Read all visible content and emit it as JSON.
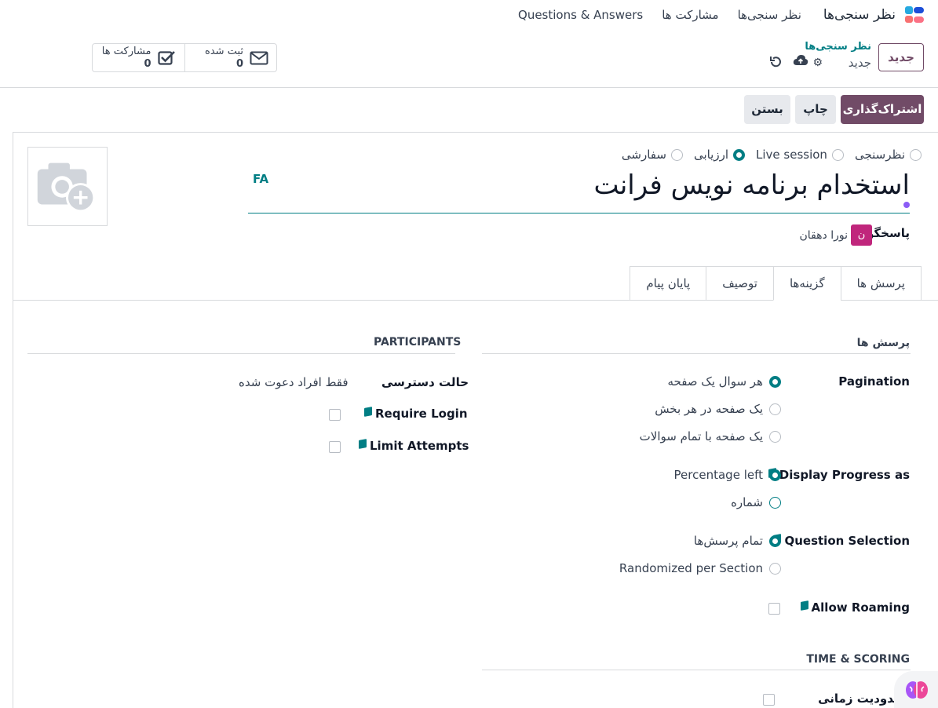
{
  "navbar": {
    "app_title": "نظر سنجی‌ها",
    "menu": [
      "نظر سنجی‌ها",
      "مشارکت ها",
      "Questions & Answers"
    ]
  },
  "header": {
    "new_button": "جدید",
    "breadcrumb_parent": "نظر سنجی‌ها",
    "breadcrumb_current": "جدید",
    "stats": [
      {
        "label": "ثبت شده",
        "value": "0",
        "icon": "envelope-icon"
      },
      {
        "label": "مشارکت ها",
        "value": "0",
        "icon": "checkbox-icon"
      }
    ]
  },
  "actions": {
    "share": "اشتراک‌گذاری",
    "print": "چاپ",
    "close": "بستن"
  },
  "form": {
    "survey_types": [
      {
        "label": "نظرسنجی",
        "selected": false
      },
      {
        "label": "Live session",
        "selected": false
      },
      {
        "label": "ارزیابی",
        "selected": true
      },
      {
        "label": "سفارشی",
        "selected": false
      }
    ],
    "language": "FA",
    "title": "استخدام برنامه نویس فرانت",
    "responsible_label": "پاسخگو",
    "responsible_initial": "ن",
    "responsible_name": "نورا دهقان"
  },
  "tabs": [
    {
      "label": "پرسش ها",
      "active": false
    },
    {
      "label": "گزینه‌ها",
      "active": true
    },
    {
      "label": "توصیف",
      "active": false
    },
    {
      "label": "پایان پیام",
      "active": false
    }
  ],
  "questions_section": {
    "title": "پرسش ها",
    "pagination_label": "Pagination",
    "pagination_options": [
      {
        "label": "هر سوال یک صفحه",
        "selected": true
      },
      {
        "label": "یک صفحه در هر بخش",
        "selected": false
      },
      {
        "label": "یک صفحه با تمام سوالات",
        "selected": false
      }
    ],
    "progress_label": "Display Progress as",
    "progress_options": [
      {
        "label": "Percentage left",
        "selected": true
      },
      {
        "label": "شماره",
        "selected": false
      }
    ],
    "selection_label": "Question Selection",
    "selection_options": [
      {
        "label": "تمام پرسش‌ها",
        "selected": true
      },
      {
        "label": "Randomized per Section",
        "selected": false
      }
    ],
    "roaming_label": "Allow Roaming",
    "roaming_checked": false
  },
  "participants_section": {
    "title": "PARTICIPANTS",
    "access_label": "حالت دسترسی",
    "access_value": "فقط افراد دعوت شده",
    "require_login_label": "Require Login",
    "require_login_checked": false,
    "limit_attempts_label": "Limit Attempts",
    "limit_attempts_checked": false
  },
  "time_section": {
    "title": "TIME & SCORING",
    "time_limit_label": "محدودیت زمانی",
    "time_limit_checked": false
  },
  "colors": {
    "brand": "#714b67",
    "accent": "#017e84"
  }
}
